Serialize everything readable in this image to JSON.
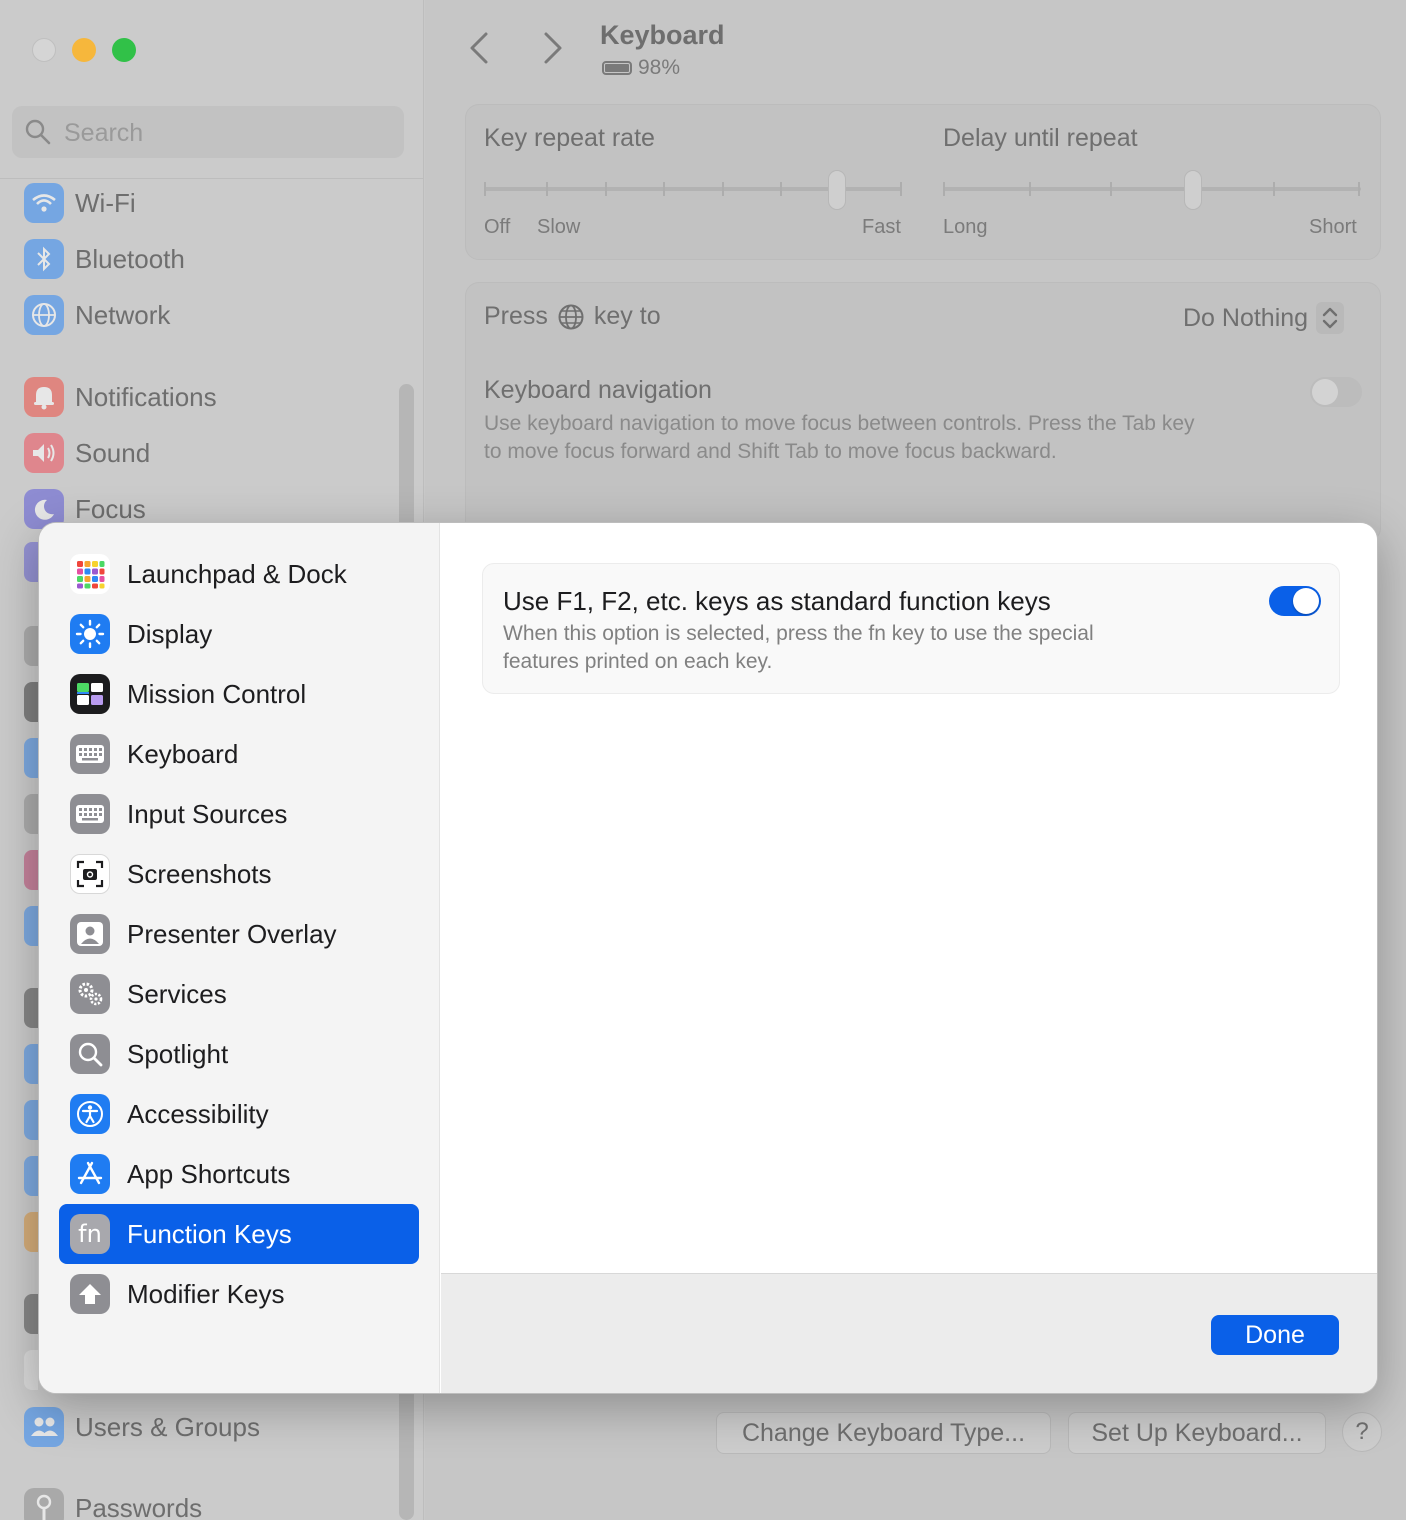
{
  "window": {
    "title": "Keyboard",
    "battery": "98%"
  },
  "search": {
    "placeholder": "Search"
  },
  "bg_sidebar": {
    "items": [
      {
        "label": "Wi-Fi",
        "icon": "wifi-icon",
        "color": "#2f88f5"
      },
      {
        "label": "Bluetooth",
        "icon": "bluetooth-icon",
        "color": "#2f88f5"
      },
      {
        "label": "Network",
        "icon": "globe-icon",
        "color": "#2f88f5"
      },
      {
        "label": "Notifications",
        "icon": "bell-icon",
        "color": "#f04e44"
      },
      {
        "label": "Sound",
        "icon": "speaker-icon",
        "color": "#f04e5c"
      },
      {
        "label": "Focus",
        "icon": "moon-icon",
        "color": "#5d5ad9"
      },
      {
        "label": "Users & Groups",
        "icon": "users-icon",
        "color": "#2f88f5"
      },
      {
        "label": "Passwords",
        "icon": "key-icon",
        "color": "#8e8e8e"
      }
    ]
  },
  "keyboard_settings": {
    "key_repeat_rate": {
      "label": "Key repeat rate",
      "off": "Off",
      "slow": "Slow",
      "fast": "Fast"
    },
    "delay_until_repeat": {
      "label": "Delay until repeat",
      "long": "Long",
      "short": "Short"
    },
    "press_key": {
      "label_prefix": "Press",
      "label_suffix": "key to",
      "value": "Do Nothing"
    },
    "keyboard_navigation": {
      "label": "Keyboard navigation",
      "description_line1": "Use keyboard navigation to move focus between controls. Press the Tab key",
      "description_line2": "to move focus forward and Shift Tab to move focus backward."
    },
    "buttons": {
      "change_type": "Change Keyboard Type...",
      "setup": "Set Up Keyboard...",
      "help": "?"
    }
  },
  "sheet": {
    "sidebar": {
      "items": [
        {
          "label": "Launchpad & Dock",
          "icon": "launchpad-icon"
        },
        {
          "label": "Display",
          "icon": "sun-icon"
        },
        {
          "label": "Mission Control",
          "icon": "mission-control-icon"
        },
        {
          "label": "Keyboard",
          "icon": "keyboard-icon"
        },
        {
          "label": "Input Sources",
          "icon": "keyboard-icon"
        },
        {
          "label": "Screenshots",
          "icon": "camera-icon"
        },
        {
          "label": "Presenter Overlay",
          "icon": "person-icon"
        },
        {
          "label": "Services",
          "icon": "gears-icon"
        },
        {
          "label": "Spotlight",
          "icon": "magnifier-icon"
        },
        {
          "label": "Accessibility",
          "icon": "accessibility-icon"
        },
        {
          "label": "App Shortcuts",
          "icon": "app-store-icon"
        },
        {
          "label": "Function Keys",
          "icon": "fn-icon",
          "selected": true
        },
        {
          "label": "Modifier Keys",
          "icon": "up-arrow-icon"
        }
      ]
    },
    "option": {
      "title": "Use F1, F2, etc. keys as standard function keys",
      "description_line1": "When this option is selected, press the fn key to use the special",
      "description_line2": "features printed on each key.",
      "enabled": true
    },
    "done_label": "Done",
    "fn_glyph": "fn",
    "accent": "#0a60e8"
  }
}
